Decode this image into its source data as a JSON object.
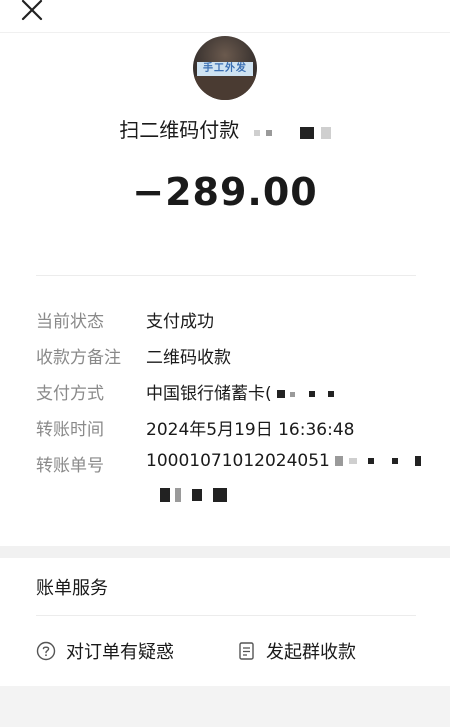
{
  "merchant": {
    "title": "扫二维码付款",
    "amount": "−289.00",
    "avatar_text": "手工外发"
  },
  "details": [
    {
      "label": "当前状态",
      "value": "支付成功"
    },
    {
      "label": "收款方备注",
      "value": "二维码收款"
    },
    {
      "label": "支付方式",
      "value": "中国银行储蓄卡("
    },
    {
      "label": "转账时间",
      "value": "2024年5月19日 16:36:48"
    },
    {
      "label": "转账单号",
      "value": "10001071012024051"
    }
  ],
  "services": {
    "title": "账单服务",
    "actions": [
      {
        "label": "对订单有疑惑",
        "icon": "question-circle-icon"
      },
      {
        "label": "发起群收款",
        "icon": "document-icon"
      }
    ]
  }
}
